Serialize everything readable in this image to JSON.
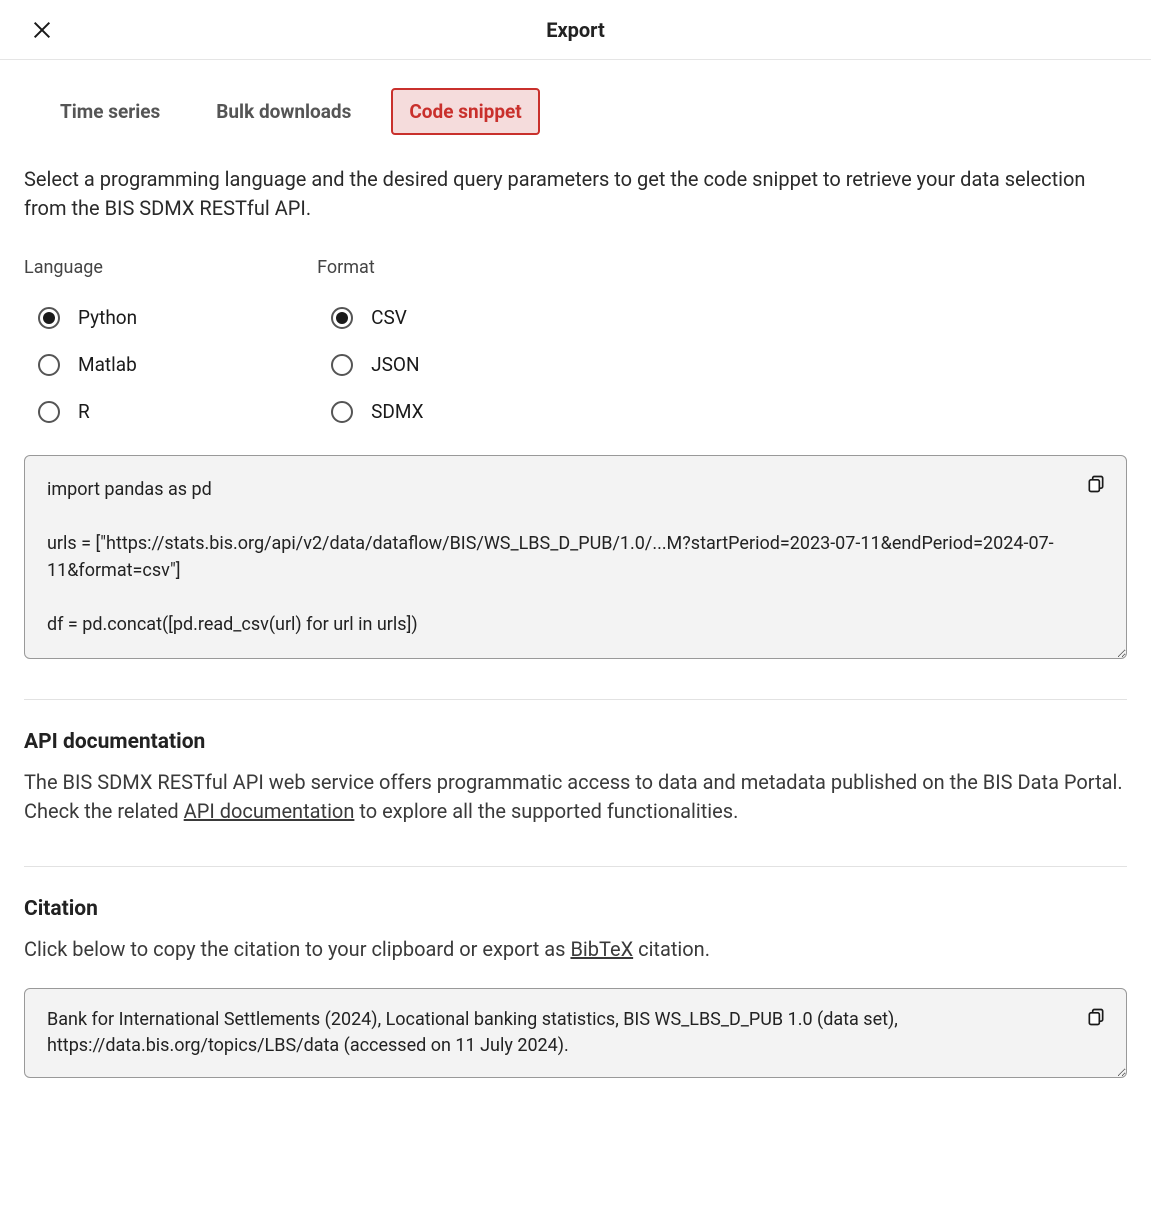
{
  "header": {
    "title": "Export"
  },
  "tabs": [
    {
      "label": "Time series",
      "active": false
    },
    {
      "label": "Bulk downloads",
      "active": false
    },
    {
      "label": "Code snippet",
      "active": true
    }
  ],
  "description": "Select a programming language and the desired query parameters to get the code snippet to retrieve your data selection from the BIS SDMX RESTful API.",
  "language": {
    "label": "Language",
    "options": [
      {
        "label": "Python",
        "selected": true
      },
      {
        "label": "Matlab",
        "selected": false
      },
      {
        "label": "R",
        "selected": false
      }
    ]
  },
  "format": {
    "label": "Format",
    "options": [
      {
        "label": "CSV",
        "selected": true
      },
      {
        "label": "JSON",
        "selected": false
      },
      {
        "label": "SDMX",
        "selected": false
      }
    ]
  },
  "code_snippet": "import pandas as pd\n\nurls = [\"https://stats.bis.org/api/v2/data/dataflow/BIS/WS_LBS_D_PUB/1.0/...M?startPeriod=2023-07-11&endPeriod=2024-07-11&format=csv\"]\n\ndf = pd.concat([pd.read_csv(url) for url in urls])",
  "api_doc": {
    "heading": "API documentation",
    "text_before": "The BIS SDMX RESTful API web service offers programmatic access to data and metadata published on the BIS Data Portal. Check the related ",
    "link": "API documentation",
    "text_after": " to explore all the supported functionalities."
  },
  "citation": {
    "heading": "Citation",
    "text_before": "Click below to copy the citation to your clipboard or export as ",
    "link": "BibTeX",
    "text_after": " citation.",
    "citation_text": "Bank for International Settlements (2024), Locational banking statistics, BIS WS_LBS_D_PUB 1.0 (data set), https://data.bis.org/topics/LBS/data (accessed on 11 July 2024)."
  }
}
